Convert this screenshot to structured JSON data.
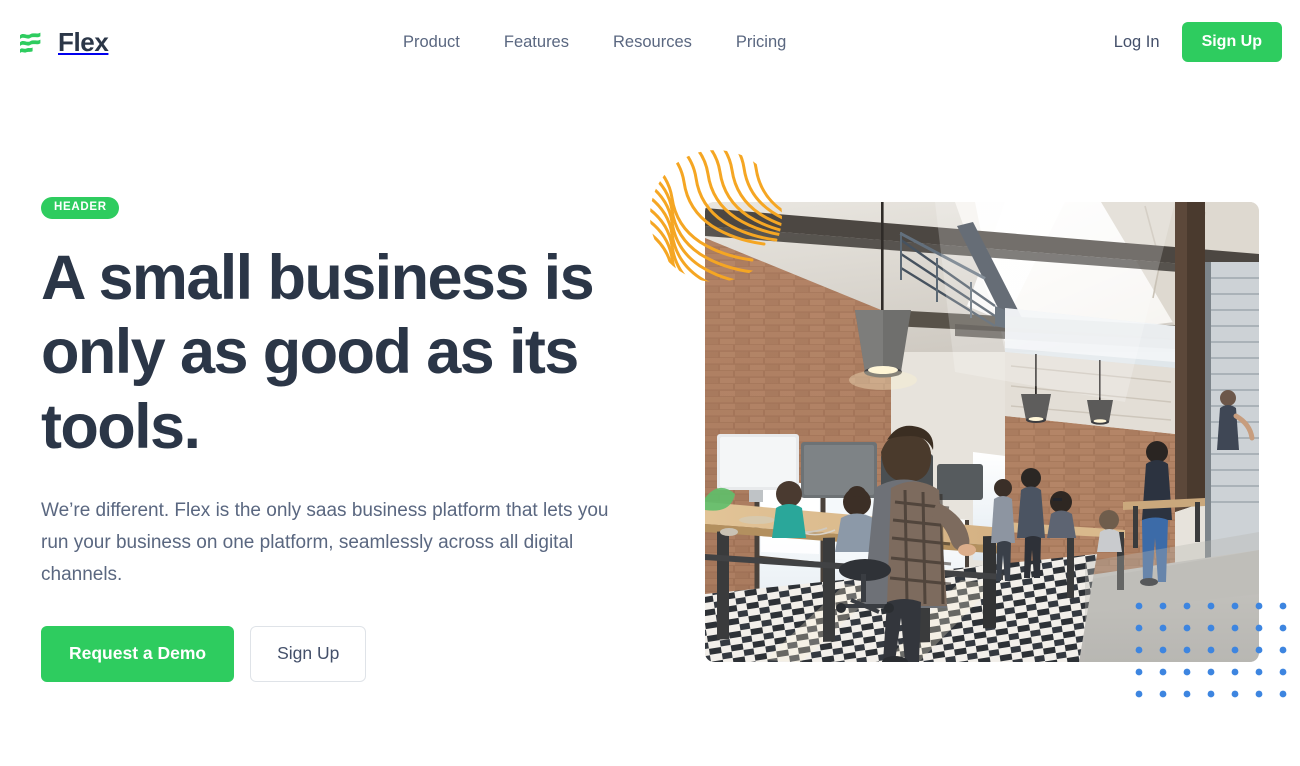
{
  "brand": {
    "name": "Flex",
    "logo_icon": "flex-wave-logo-icon",
    "logo_color": "#2ecc5f"
  },
  "nav": {
    "items": [
      {
        "label": "Product"
      },
      {
        "label": "Features"
      },
      {
        "label": "Resources"
      },
      {
        "label": "Pricing"
      }
    ]
  },
  "header_actions": {
    "login_label": "Log In",
    "signup_label": "Sign Up"
  },
  "hero": {
    "badge": "HEADER",
    "title": "A small business is only as good as its tools.",
    "subtitle": "We’re different. Flex is the only saas business platform that lets you run your business on one platform, seamlessly across all digital channels.",
    "primary_cta": "Request a Demo",
    "secondary_cta": "Sign Up",
    "photo_alt": "Open-plan industrial loft office with exposed brick walls, pendant lamps, long wooden desk, striped rug and colleagues working at computers",
    "decoration_wave_color": "#f5a623",
    "decoration_dots_color": "#3d85e0"
  },
  "theme": {
    "accent_green": "#2ecc5f",
    "heading_navy": "#2b3647",
    "body_slate": "#5a6780",
    "border_gray": "#dfe3e8",
    "background": "#ffffff"
  }
}
